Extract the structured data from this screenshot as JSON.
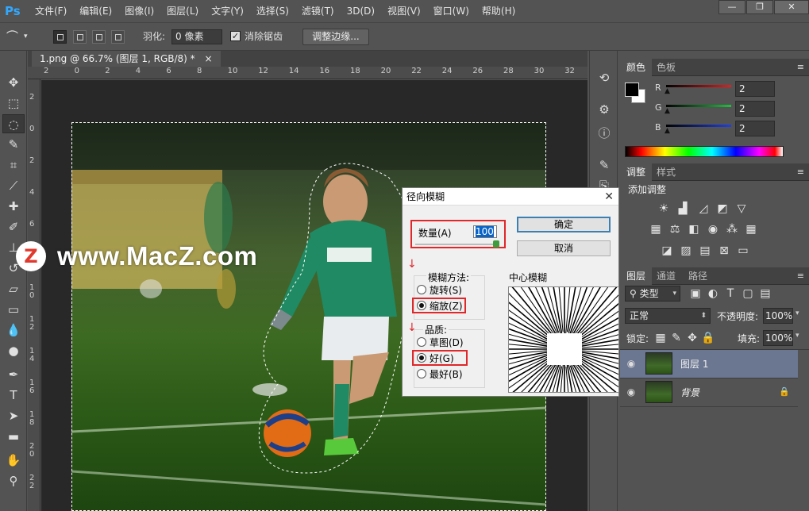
{
  "app": {
    "logo": "Ps"
  },
  "menu": [
    "文件(F)",
    "编辑(E)",
    "图像(I)",
    "图层(L)",
    "文字(Y)",
    "选择(S)",
    "滤镜(T)",
    "3D(D)",
    "视图(V)",
    "窗口(W)",
    "帮助(H)"
  ],
  "window_controls": {
    "minimize": "—",
    "restore": "❐",
    "close": "✕"
  },
  "options": {
    "feather_label": "羽化:",
    "feather_value": "0 像素",
    "antialias_label": "消除锯齿",
    "antialias_checked": true,
    "refine_button": "调整边缘..."
  },
  "document": {
    "tab_title": "1.png @ 66.7% (图层 1, RGB/8) *",
    "tab_close": "×",
    "ruler_h_ticks": [
      "2",
      "0",
      "2",
      "4",
      "6",
      "8",
      "10",
      "12",
      "14",
      "16",
      "18",
      "20",
      "22",
      "24",
      "26",
      "28",
      "30",
      "32"
    ],
    "ruler_v_ticks": [
      "2",
      "0",
      "2",
      "4",
      "6",
      "8",
      "1\n0",
      "1\n2",
      "1\n4",
      "1\n6",
      "1\n8",
      "2\n0",
      "2\n2"
    ]
  },
  "watermark": {
    "logo": "Z",
    "text": "www.MacZ.com"
  },
  "color_panel": {
    "tabs": [
      "颜色",
      "色板"
    ],
    "channels": [
      {
        "label": "R",
        "value": "2",
        "color": "#e02020"
      },
      {
        "label": "G",
        "value": "2",
        "color": "#20c040"
      },
      {
        "label": "B",
        "value": "2",
        "color": "#2040e0"
      }
    ]
  },
  "adjustments_panel": {
    "tabs": [
      "调整",
      "样式"
    ],
    "heading": "添加调整"
  },
  "layers_panel": {
    "tabs": [
      "图层",
      "通道",
      "路径"
    ],
    "filter_kind": "类型",
    "blend_mode": "正常",
    "opacity_label": "不透明度:",
    "opacity_value": "100%",
    "lock_label": "锁定:",
    "fill_label": "填充:",
    "fill_value": "100%",
    "layers": [
      {
        "name": "图层 1",
        "selected": true,
        "locked": false
      },
      {
        "name": "背景",
        "selected": false,
        "locked": true
      }
    ]
  },
  "dialog": {
    "title": "径向模糊",
    "close": "✕",
    "amount_label": "数量(A)",
    "amount_value": "100",
    "ok_button": "确定",
    "cancel_button": "取消",
    "method_label": "模糊方法:",
    "methods": [
      {
        "label": "旋转(S)",
        "checked": false
      },
      {
        "label": "缩放(Z)",
        "checked": true
      }
    ],
    "quality_label": "品质:",
    "qualities": [
      {
        "label": "草图(D)",
        "checked": false
      },
      {
        "label": "好(G)",
        "checked": true
      },
      {
        "label": "最好(B)",
        "checked": false
      }
    ],
    "center_label": "中心模糊",
    "highlight_color": "#e0272a"
  }
}
